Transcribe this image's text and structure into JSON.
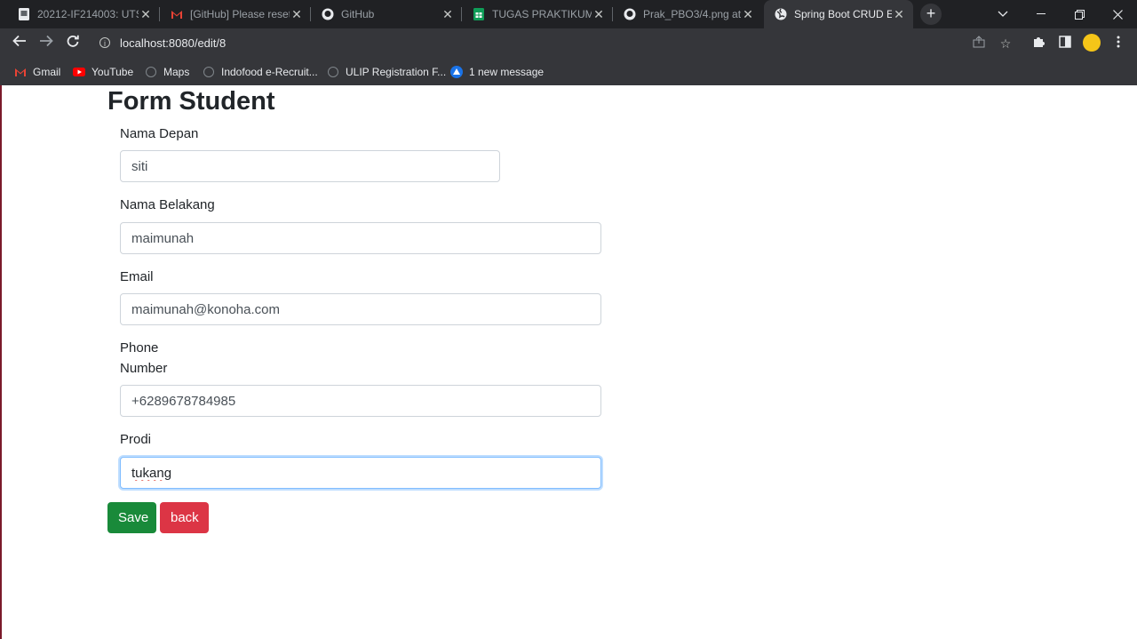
{
  "browser": {
    "tabs": [
      {
        "title": "20212-IF214003: UTS",
        "icon": "document-icon"
      },
      {
        "title": "[GitHub] Please reset",
        "icon": "gmail-icon"
      },
      {
        "title": "GitHub",
        "icon": "github-icon"
      },
      {
        "title": "TUGAS PRAKTIKUM P",
        "icon": "sheets-icon"
      },
      {
        "title": "Prak_PBO3/4.png at m",
        "icon": "github-icon"
      },
      {
        "title": "Spring Boot CRUD Ex",
        "icon": "globe-icon",
        "active": true
      }
    ],
    "new_tab_label": "+",
    "url": "localhost:8080/edit/8",
    "bookmarks": [
      {
        "label": "Gmail",
        "icon": "gmail-icon"
      },
      {
        "label": "YouTube",
        "icon": "youtube-icon"
      },
      {
        "label": "Maps",
        "icon": "globe-icon"
      },
      {
        "label": "Indofood e-Recruit...",
        "icon": "globe-icon"
      },
      {
        "label": "ULIP Registration F...",
        "icon": "globe-icon"
      },
      {
        "label": "1 new message",
        "icon": "message-icon"
      }
    ]
  },
  "form": {
    "title": "Form Student",
    "fields": [
      {
        "label": "Nama Depan",
        "value": "siti"
      },
      {
        "label": "Nama Belakang",
        "value": "maimunah"
      },
      {
        "label": "Email",
        "value": "maimunah@konoha.com"
      },
      {
        "label_line1": "Phone",
        "label_line2": "Number",
        "value": "+6289678784985"
      },
      {
        "label": "Prodi",
        "value": "tukang",
        "focused": true
      }
    ],
    "save_label": "Save",
    "back_label": "back"
  },
  "colors": {
    "save": "#198a3a",
    "back": "#dc3545",
    "chrome_dark": "#202124",
    "chrome_toolbar": "#35363a"
  }
}
